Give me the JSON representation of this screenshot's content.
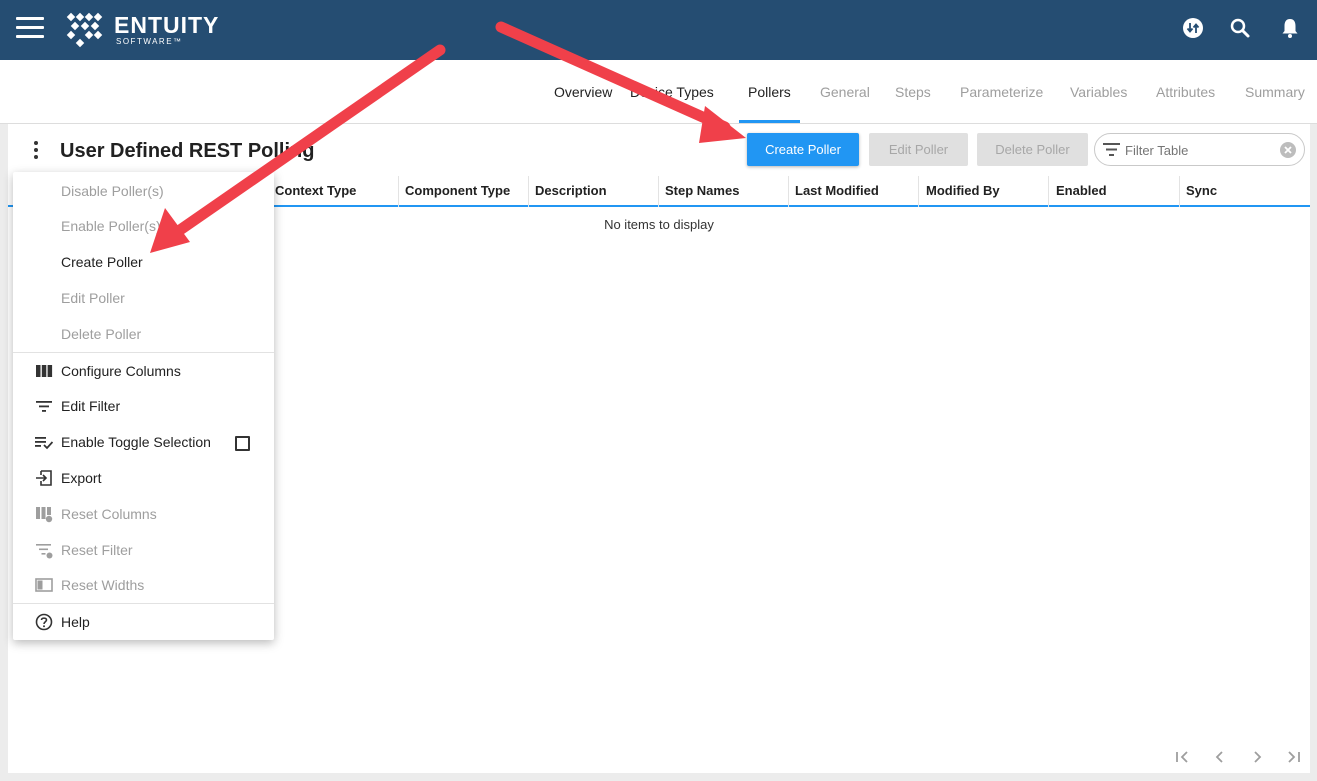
{
  "header": {
    "logo_word": "ENTUITY",
    "logo_sub": "SOFTWARE™",
    "icons": [
      "hamburger-icon",
      "sync-icon",
      "search-icon",
      "bell-icon"
    ]
  },
  "nav": {
    "tabs": [
      {
        "label": "Overview",
        "state": "enabled"
      },
      {
        "label": "Device Types",
        "state": "enabled"
      },
      {
        "label": "Pollers",
        "state": "active"
      },
      {
        "label": "General",
        "state": "disabled"
      },
      {
        "label": "Steps",
        "state": "disabled"
      },
      {
        "label": "Parameterize",
        "state": "disabled"
      },
      {
        "label": "Variables",
        "state": "disabled"
      },
      {
        "label": "Attributes",
        "state": "disabled"
      },
      {
        "label": "Summary",
        "state": "disabled"
      }
    ],
    "accent": "#2196f3"
  },
  "page": {
    "title": "User Defined REST Polling"
  },
  "toolbar": {
    "create_label": "Create Poller",
    "edit_label": "Edit Poller",
    "delete_label": "Delete Poller",
    "filter_placeholder": "Filter Table"
  },
  "table": {
    "columns": [
      "Context Type",
      "Component Type",
      "Description",
      "Step Names",
      "Last Modified",
      "Modified By",
      "Enabled",
      "Sync"
    ],
    "empty_message": "No items to display"
  },
  "menu": {
    "items": [
      {
        "label": "Disable Poller(s)",
        "enabled": false,
        "icon": ""
      },
      {
        "label": "Enable Poller(s)",
        "enabled": false,
        "icon": ""
      },
      {
        "label": "Create Poller",
        "enabled": true,
        "icon": ""
      },
      {
        "label": "Edit Poller",
        "enabled": false,
        "icon": ""
      },
      {
        "label": "Delete Poller",
        "enabled": false,
        "icon": ""
      },
      {
        "label": "Configure Columns",
        "enabled": true,
        "icon": "columns-icon"
      },
      {
        "label": "Edit Filter",
        "enabled": true,
        "icon": "filter-icon"
      },
      {
        "label": "Enable Toggle Selection",
        "enabled": true,
        "icon": "checklist-icon"
      },
      {
        "label": "Export",
        "enabled": true,
        "icon": "export-icon"
      },
      {
        "label": "Reset Columns",
        "enabled": false,
        "icon": "reset-columns-icon"
      },
      {
        "label": "Reset Filter",
        "enabled": false,
        "icon": "reset-filter-icon"
      },
      {
        "label": "Reset Widths",
        "enabled": false,
        "icon": "reset-widths-icon"
      },
      {
        "label": "Help",
        "enabled": true,
        "icon": "help-icon"
      }
    ],
    "toggle_selection_checked": false
  },
  "annotations": {
    "arrow_color": "#f0404a"
  }
}
